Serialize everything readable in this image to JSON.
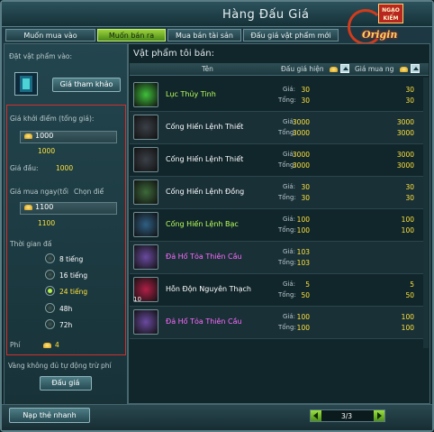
{
  "window": {
    "title": "Hàng Đấu Giá"
  },
  "logo": {
    "seal_text": "NGẠO KIẾM",
    "brand_text": "Origin"
  },
  "tabs": [
    {
      "label": "Muốn mua vào",
      "active": false
    },
    {
      "label": "Muốn bán ra",
      "active": true
    },
    {
      "label": "Mua bán tài sản",
      "active": false
    },
    {
      "label": "Đấu giá vật phẩm mới",
      "active": false
    }
  ],
  "left": {
    "place_item_label": "Đặt vật phẩm vào:",
    "reference_price_button": "Giá tham khảo",
    "start_price_label": "Giá khởi điểm (tổng giá):",
    "start_price_value": "1000",
    "start_price_total": "1000",
    "bid_label": "Giá đầu:",
    "bid_value": "1000",
    "buyout_label": "Giá mua ngay(tổi",
    "choose_label": "Chọn điể",
    "buyout_value": "1100",
    "buyout_total": "1100",
    "time_label": "Thời gian đấ",
    "durations": [
      {
        "label": "8 tiếng",
        "selected": false
      },
      {
        "label": "16 tiếng",
        "selected": false
      },
      {
        "label": "24 tiếng",
        "selected": true
      },
      {
        "label": "48h",
        "selected": false
      },
      {
        "label": "72h",
        "selected": false
      }
    ],
    "fee_label": "Phí",
    "fee_value": "4",
    "warning": "Vàng không đủ tự động trừ phí",
    "auction_button": "Đấu giá",
    "recharge_button": "Nạp thẻ nhanh"
  },
  "list": {
    "section_title": "Vật phẩm tôi bán:",
    "columns": {
      "name": "Tên",
      "current_bid": "Đấu giá hiện",
      "buyout": "Giá mua ng"
    },
    "price_label": "Giá:",
    "total_label": "Tổng:",
    "items": [
      {
        "name": "Lục Thủy Tinh",
        "color": "#b8ff5a",
        "icon": "green-crystal-icon",
        "icon_color": "#3fbf3a",
        "bid": "30",
        "bid_total": "30",
        "buy": "30",
        "buy_total": "30",
        "qty": ""
      },
      {
        "name": "Cống Hiến Lệnh Thiết",
        "color": "#ffffff",
        "icon": "iron-token-icon",
        "icon_color": "#3b4048",
        "bid": "3000",
        "bid_total": "3000",
        "buy": "3000",
        "buy_total": "3000",
        "qty": ""
      },
      {
        "name": "Cống Hiến Lệnh Thiết",
        "color": "#ffffff",
        "icon": "iron-token-icon",
        "icon_color": "#3b4048",
        "bid": "3000",
        "bid_total": "3000",
        "buy": "3000",
        "buy_total": "3000",
        "qty": ""
      },
      {
        "name": "Cống Hiến Lệnh Đồng",
        "color": "#ffffff",
        "icon": "bronze-token-icon",
        "icon_color": "#3d6a3a",
        "bid": "30",
        "bid_total": "30",
        "buy": "30",
        "buy_total": "30",
        "qty": ""
      },
      {
        "name": "Cống Hiến Lệnh Bạc",
        "color": "#b8ff5a",
        "icon": "silver-token-icon",
        "icon_color": "#2f5f84",
        "bid": "100",
        "bid_total": "100",
        "buy": "100",
        "buy_total": "100",
        "qty": ""
      },
      {
        "name": "Đả Hổ Tỏa Thiên Cầu",
        "color": "#ff6bff",
        "icon": "armor-icon",
        "icon_color": "#6a4aa0",
        "bid": "103",
        "bid_total": "103",
        "buy": "",
        "buy_total": "",
        "qty": ""
      },
      {
        "name": "Hỗn Độn Nguyên Thạch",
        "color": "#ffffff",
        "icon": "red-stone-icon",
        "icon_color": "#b11f48",
        "bid": "5",
        "bid_total": "50",
        "buy": "5",
        "buy_total": "50",
        "qty": "10"
      },
      {
        "name": "Đả Hổ Tỏa Thiên Cầu",
        "color": "#ff6bff",
        "icon": "armor-icon",
        "icon_color": "#6a4aa0",
        "bid": "100",
        "bid_total": "100",
        "buy": "100",
        "buy_total": "100",
        "qty": ""
      }
    ]
  },
  "pager": {
    "text": "3/3"
  }
}
